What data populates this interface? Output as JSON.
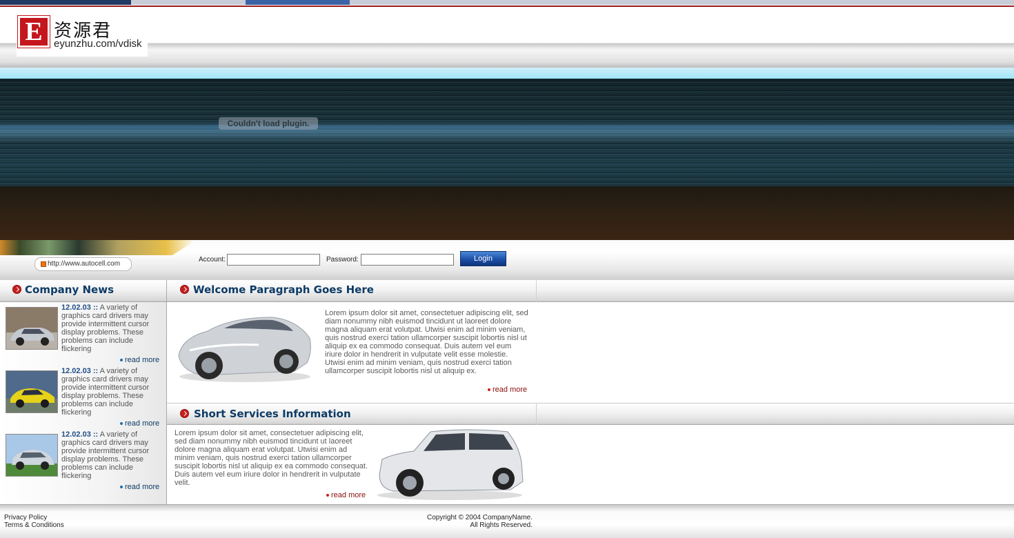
{
  "logo": {
    "mark": "E",
    "name": "资源君",
    "url": "eyunzhu.com/vdisk"
  },
  "banner": {
    "plugin_message": "Couldn't load plugin."
  },
  "login": {
    "url_text": "http://www.autocell.com",
    "account_label": "Account:",
    "password_label": "Password:",
    "account_value": "",
    "password_value": "",
    "button_label": "Login"
  },
  "company_news": {
    "title": "Company News",
    "items": [
      {
        "date": "12.02.03 ::",
        "text": " A variety of graphics card drivers may provide intermittent cursor display problems. These problems can include flickering",
        "read_more": "read more"
      },
      {
        "date": "12.02.03 ::",
        "text": " A variety of graphics card drivers may provide intermittent cursor display problems. These problems can include flickering",
        "read_more": "read more"
      },
      {
        "date": "12.02.03 ::",
        "text": " A variety of graphics card drivers may provide intermittent cursor display problems. These problems can include flickering",
        "read_more": "read more"
      }
    ]
  },
  "welcome": {
    "title": "Welcome Paragraph Goes Here",
    "text": "Lorem ipsum dolor sit amet, consectetuer adipiscing elit, sed diam nonummy nibh euismod tincidunt ut laoreet dolore magna aliquam erat volutpat. Utwisi enim ad minim veniam, quis nostrud exerci tation ullamcorper suscipit lobortis nisl ut aliquip ex ea commodo consequat. Duis autem vel eum iriure dolor in hendrerit in vulputate velit esse molestie. Utwisi enim ad minim veniam, quis nostrud exerci tation ullamcorper suscipit lobortis nisl ut aliquip ex.",
    "read_more": "read more"
  },
  "services": {
    "title": "Short Services Information",
    "text": "Lorem ipsum dolor sit amet, consectetuer adipiscing elit, sed diam nonummy nibh euismod tincidunt ut laoreet dolore magna aliquam erat volutpat. Utwisi enim ad minim veniam, quis nostrud exerci tation ullamcorper suscipit lobortis nisl ut aliquip ex ea commodo consequat. Duis autem vel eum iriure dolor in hendrerit in vulputate velit.",
    "read_more": "read more"
  },
  "footer": {
    "privacy": "Privacy Policy",
    "terms": "Terms & Conditions",
    "copyright": "Copyright © 2004 CompanyName.",
    "rights": "All Rights Reserved."
  },
  "colors": {
    "brand_red": "#c4161c",
    "title_blue": "#0d3b66",
    "readmore_red": "#8a0d0d"
  }
}
